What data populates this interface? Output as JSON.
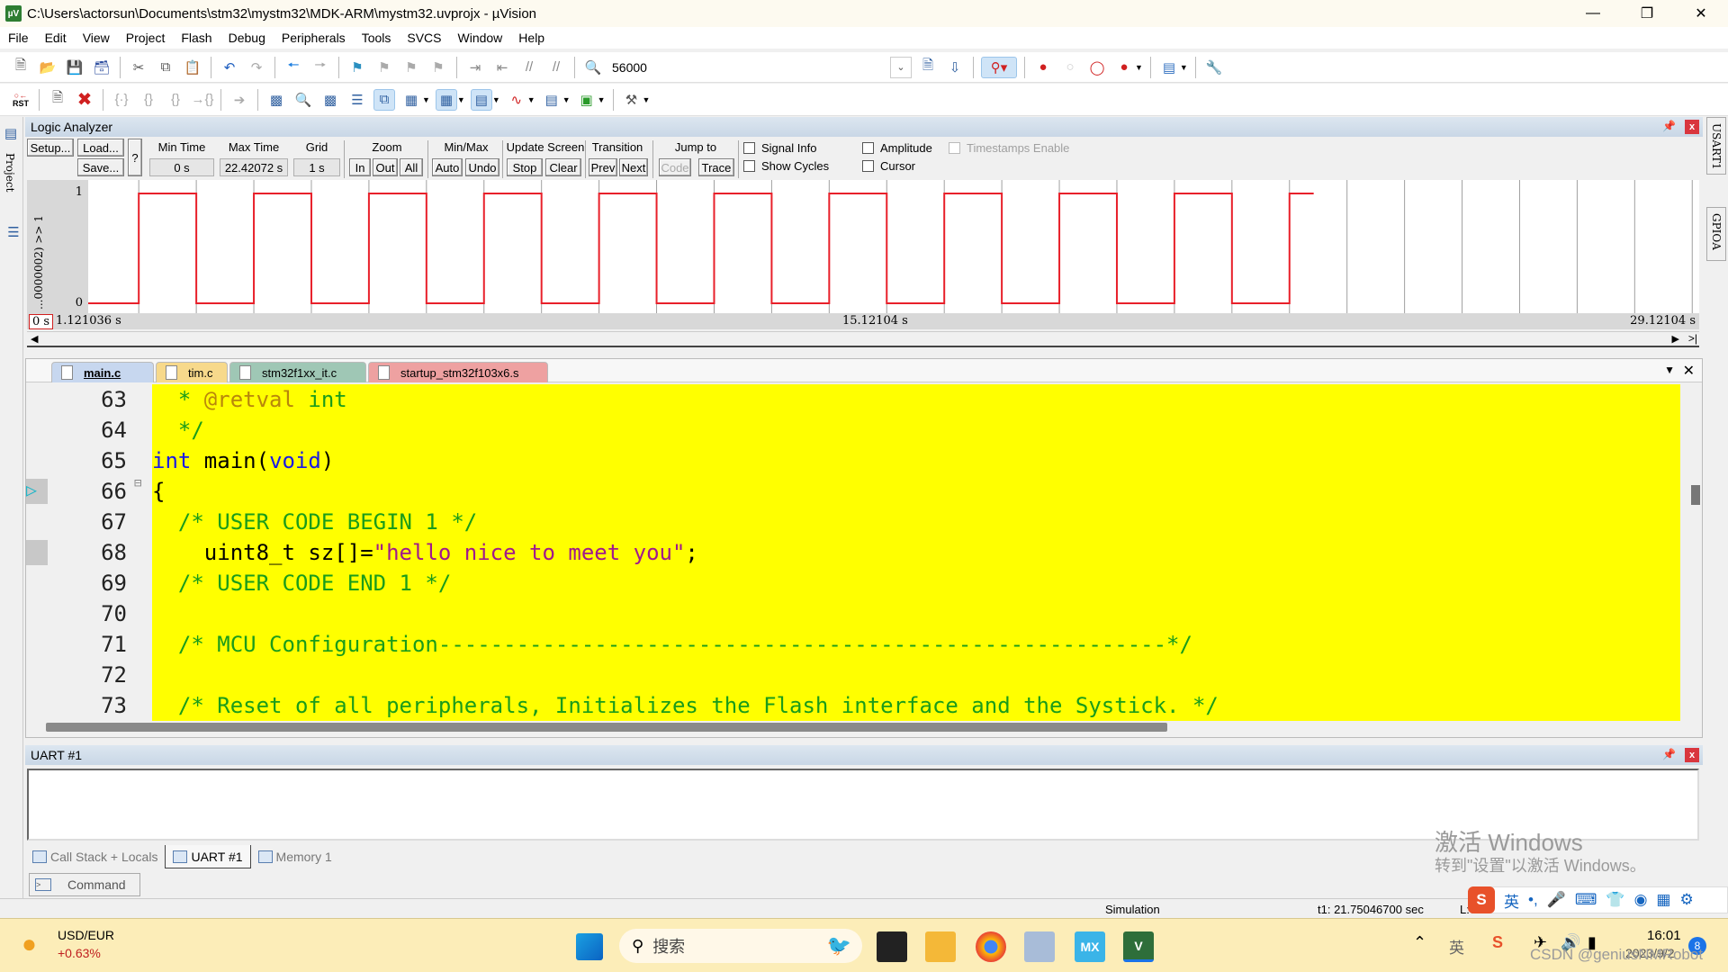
{
  "window": {
    "title": "C:\\Users\\actorsun\\Documents\\stm32\\mystm32\\MDK-ARM\\mystm32.uvprojx - µVision",
    "app_icon": "uvision-icon",
    "controls": [
      "minimize-icon",
      "restore-icon",
      "close-icon"
    ]
  },
  "menu": [
    "File",
    "Edit",
    "View",
    "Project",
    "Flash",
    "Debug",
    "Peripherals",
    "Tools",
    "SVCS",
    "Window",
    "Help"
  ],
  "toolbar1": {
    "icons": [
      "new-file-icon",
      "open-folder-icon",
      "save-icon",
      "save-all-icon",
      "cut-icon",
      "copy-icon",
      "paste-icon",
      "undo-icon",
      "redo-icon",
      "back-icon",
      "forward-icon",
      "bookmark-icon",
      "prev-bookmark-icon",
      "next-bookmark-icon",
      "clear-bookmarks-icon",
      "indent-icon",
      "unindent-icon",
      "comment-icon",
      "uncomment-icon",
      "find-in-files-icon"
    ],
    "find_value": "56000",
    "icons_right": [
      "find-icon",
      "incremental-find-icon",
      "debug-session-icon",
      "breakpoint-insert-icon",
      "breakpoint-disable-icon",
      "breakpoint-disable-all-icon",
      "breakpoint-kill-all-icon",
      "window-layout-icon",
      "configure-icon"
    ]
  },
  "toolbar2": {
    "rst_label": "RST",
    "icons": [
      "reset-icon",
      "run-icon",
      "stop-icon",
      "step-into-icon",
      "step-over-icon",
      "step-out-icon",
      "run-to-cursor-icon",
      "show-next-statement-icon",
      "command-window-icon",
      "disassembly-window-icon",
      "symbols-window-icon",
      "registers-window-icon",
      "call-stack-window-icon",
      "watch-window-icon",
      "memory-window-icon",
      "serial-window-icon",
      "analysis-window-icon",
      "trace-window-icon",
      "system-viewer-icon",
      "toolbox-icon"
    ]
  },
  "logic_analyzer": {
    "title": "Logic Analyzer",
    "buttons": {
      "setup": "Setup...",
      "load": "Load...",
      "save": "Save...",
      "help": "?"
    },
    "min_time_label": "Min Time",
    "min_time": "0 s",
    "max_time_label": "Max Time",
    "max_time": "22.42072 s",
    "grid_label": "Grid",
    "grid": "1 s",
    "zoom_label": "Zoom",
    "zoom_buttons": [
      "In",
      "Out",
      "All"
    ],
    "minmax_label": "Min/Max",
    "minmax_buttons": [
      "Auto",
      "Undo"
    ],
    "update_label": "Update Screen",
    "update_buttons": [
      "Stop",
      "Clear"
    ],
    "transition_label": "Transition",
    "transition_buttons": [
      "Prev",
      "Next"
    ],
    "jump_label": "Jump to",
    "jump_buttons": [
      "Code",
      "Trace"
    ],
    "checkboxes": [
      {
        "label": "Signal Info",
        "checked": false,
        "enabled": true
      },
      {
        "label": "Amplitude",
        "checked": false,
        "enabled": true
      },
      {
        "label": "Timestamps Enable",
        "checked": false,
        "enabled": false
      },
      {
        "label": "Show Cycles",
        "checked": false,
        "enabled": true
      },
      {
        "label": "Cursor",
        "checked": false,
        "enabled": true
      }
    ],
    "signal_name": "...0000002) >> 1",
    "y_max": "1",
    "y_min": "0",
    "axis_start": "0 s",
    "axis_left": "1.121036 s",
    "axis_mid": "15.12104 s",
    "axis_right": "29.12104 s",
    "signal_color": "#e8202a",
    "waveform": {
      "view_start_s": 1.121036,
      "view_end_s": 29.12104,
      "grid_s": 1,
      "end_s": 22.42072,
      "transitions_s": [
        2.0,
        3.0,
        4.0,
        5.0,
        6.0,
        7.0,
        8.0,
        9.0,
        10.0,
        11.0,
        12.0,
        13.0,
        14.0,
        15.0,
        16.0,
        17.0,
        18.0,
        19.0,
        20.0,
        21.0,
        22.0
      ],
      "initial_level": 0
    }
  },
  "editor": {
    "tabs": [
      {
        "label": "main.c",
        "active": true,
        "color": "#c7d7ef"
      },
      {
        "label": "tim.c",
        "active": false,
        "color": "#f7d98b"
      },
      {
        "label": "stm32f1xx_it.c",
        "active": false,
        "color": "#9fc7b5"
      },
      {
        "label": "startup_stm32f103x6.s",
        "active": false,
        "color": "#eea1a1"
      }
    ],
    "lines": [
      {
        "n": "63",
        "parts": [
          [
            "c-com",
            "  * "
          ],
          [
            "c-tag",
            "@retval"
          ],
          [
            "c-com",
            " int"
          ]
        ]
      },
      {
        "n": "64",
        "parts": [
          [
            "c-com",
            "  */"
          ]
        ]
      },
      {
        "n": "65",
        "parts": [
          [
            "c-kw",
            "int"
          ],
          [
            "",
            " main("
          ],
          [
            "c-kw",
            "void"
          ],
          [
            "",
            ")"
          ]
        ]
      },
      {
        "n": "66",
        "parts": [
          [
            "",
            "{"
          ]
        ],
        "current": true
      },
      {
        "n": "67",
        "parts": [
          [
            "c-com",
            "  /* USER CODE BEGIN 1 */"
          ]
        ]
      },
      {
        "n": "68",
        "parts": [
          [
            "",
            "    uint8_t sz[]="
          ],
          [
            "c-str",
            "\"hello nice to meet you\""
          ],
          [
            "",
            ";"
          ]
        ]
      },
      {
        "n": "69",
        "parts": [
          [
            "c-com",
            "  /* USER CODE END 1 */"
          ]
        ]
      },
      {
        "n": "70",
        "parts": [
          [
            "",
            ""
          ]
        ]
      },
      {
        "n": "71",
        "parts": [
          [
            "c-com",
            "  /* MCU Configuration--------------------------------------------------------*/"
          ]
        ]
      },
      {
        "n": "72",
        "parts": [
          [
            "",
            ""
          ]
        ]
      },
      {
        "n": "73",
        "parts": [
          [
            "c-com",
            "  /* Reset of all peripherals, Initializes the Flash interface and the Systick. */"
          ]
        ]
      }
    ]
  },
  "uart_panel": {
    "title": "UART #1",
    "content": ""
  },
  "bottom_tabs": [
    {
      "label": "Call Stack + Locals",
      "active": false
    },
    {
      "label": "UART #1",
      "active": true
    },
    {
      "label": "Memory 1",
      "active": false
    }
  ],
  "command_tab": "Command",
  "side_tabs": {
    "left": "Project",
    "right": [
      "USART1",
      "GPIOA"
    ]
  },
  "status": {
    "mode": "Simulation",
    "t1": "t1: 21.75046700 sec",
    "line": "L:6"
  },
  "watermark": {
    "line1": "激活 Windows",
    "line2": "转到\"设置\"以激活 Windows。",
    "csdn": "CSDN @geniusNMRobot"
  },
  "ime": {
    "lang": "英",
    "icons": [
      "sogou-icon",
      "punctuation-icon",
      "mic-icon",
      "keyboard-icon",
      "skin-icon",
      "robot-icon",
      "apps-icon",
      "settings-icon"
    ]
  },
  "taskbar": {
    "widget_label": "USD/EUR",
    "widget_value": "+0.63%",
    "search_placeholder": "搜索",
    "apps": [
      "start-icon",
      "task-view-icon",
      "file-explorer-icon",
      "chrome-icon",
      "network-tool-icon",
      "stm32cubemx-icon",
      "keil-uvision-icon"
    ],
    "tray_lang": "英",
    "time": "16:01",
    "date": "2023/9/2",
    "notifications": "8"
  }
}
